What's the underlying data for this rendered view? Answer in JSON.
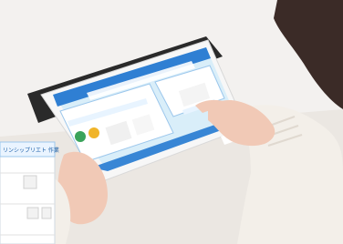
{
  "scene": {
    "description_colors": {
      "background": "#f3f1ef",
      "table": "#e9e6e2",
      "tablet_frame": "#f7f7f7",
      "tablet_screen_bg": "#d9eef9",
      "ui_header_blue": "#2f7fd3",
      "ui_panel_white": "#ffffff",
      "skin": "#f1c9b6",
      "sweater": "#f3efe9",
      "hair": "#3b2b27",
      "cover_dark": "#2a2a2a"
    }
  },
  "inset_sheet": {
    "header_label": "リンシップリエト 作業"
  },
  "tablet_ui": {
    "nav_next": "→"
  },
  "icons": {
    "tablet": "tablet-icon",
    "pen": "pen-icon",
    "document": "document-icon",
    "arrow": "arrow-icon"
  }
}
